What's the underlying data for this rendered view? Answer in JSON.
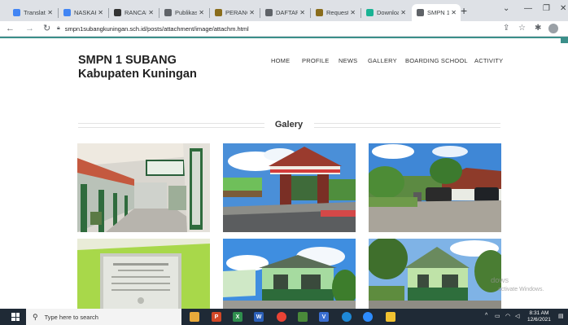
{
  "browser": {
    "tabs": [
      {
        "title": "Translat",
        "icon": "google-translate-icon",
        "color": "#4285f4"
      },
      {
        "title": "NASKAH",
        "icon": "document-icon",
        "color": "#4285f4"
      },
      {
        "title": "RANCAN",
        "icon": "pkp-icon",
        "color": "#333333"
      },
      {
        "title": "Publikas",
        "icon": "globe-icon",
        "color": "#5f6368"
      },
      {
        "title": "PERANC",
        "icon": "institution-icon",
        "color": "#8a6d1c"
      },
      {
        "title": "DAFTAR",
        "icon": "globe-icon",
        "color": "#5f6368"
      },
      {
        "title": "Request",
        "icon": "institution-icon",
        "color": "#8a6d1c"
      },
      {
        "title": "Downloa",
        "icon": "download-site-icon",
        "color": "#1ab394"
      },
      {
        "title": "SMPN 1",
        "icon": "globe-icon",
        "color": "#5f6368"
      }
    ],
    "new_tab": "+",
    "url": "smpn1subangkuningan.sch.id/posts/attachment/image/attachm.html"
  },
  "site": {
    "title": "SMPN 1 SUBANG",
    "subtitle": "Kabupaten Kuningan",
    "menu": [
      "HOME",
      "PROFILE",
      "NEWS",
      "GALLERY",
      "BOARDING SCHOOL",
      "ACTIVITY"
    ]
  },
  "gallery": {
    "title": "Galery",
    "photos": [
      {
        "name": "school-corridor-photo"
      },
      {
        "name": "school-gate-photo"
      },
      {
        "name": "school-parking-photo"
      },
      {
        "name": "school-plaque-photo"
      },
      {
        "name": "school-building-photo"
      },
      {
        "name": "school-front-photo"
      }
    ]
  },
  "watermark": {
    "line1": "dows",
    "line2": "activate Windows."
  },
  "taskbar": {
    "search_placeholder": "Type here to search",
    "time": "8:31 AM",
    "date": "12/6/2021"
  }
}
